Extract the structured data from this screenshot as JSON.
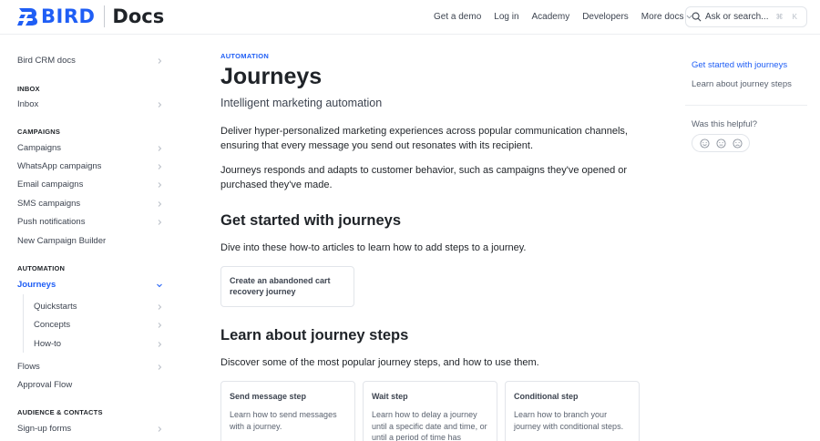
{
  "brand": {
    "name": "BIRD",
    "section": "Docs",
    "color": "#1f5ef5"
  },
  "topnav": {
    "items": [
      "Get a demo",
      "Log in",
      "Academy",
      "Developers"
    ],
    "more_label": "More docs"
  },
  "search": {
    "placeholder": "Ask or search...",
    "shortcut": "⌘ K"
  },
  "sidebar": {
    "top_item": "Bird CRM docs",
    "inbox_heading": "INBOX",
    "inbox_items": [
      "Inbox"
    ],
    "campaigns_heading": "CAMPAIGNS",
    "campaigns_items": [
      "Campaigns",
      "WhatsApp campaigns",
      "Email campaigns",
      "SMS campaigns",
      "Push notifications",
      "New Campaign Builder"
    ],
    "automation_heading": "AUTOMATION",
    "active_item": "Journeys",
    "journeys_children": [
      "Quickstarts",
      "Concepts",
      "How-to"
    ],
    "automation_items": [
      "Flows",
      "Approval Flow"
    ],
    "audience_heading": "AUDIENCE & CONTACTS",
    "audience_items": [
      "Sign-up forms"
    ]
  },
  "main": {
    "eyebrow": "AUTOMATION",
    "title": "Journeys",
    "subtitle": "Intelligent marketing automation",
    "para1": "Deliver hyper-personalized marketing experiences across popular communication channels, ensuring that every message you send out resonates with its recipient.",
    "para2": "Journeys responds and adapts to customer behavior, such as campaigns they've opened or purchased they've made.",
    "section1_heading": "Get started with journeys",
    "section1_text": "Dive into these how-to articles to learn how to add steps to a journey.",
    "section1_card": "Create an abandoned cart recovery journey",
    "section2_heading": "Learn about journey steps",
    "section2_text": "Discover some of the most popular journey steps, and how to use them.",
    "step_cards": [
      {
        "title": "Send message step",
        "desc": "Learn how to send messages with a journey."
      },
      {
        "title": "Wait step",
        "desc": "Learn how to delay a journey until a specific date and time, or until a period of time has"
      },
      {
        "title": "Conditional step",
        "desc": "Learn how to branch your journey with conditional steps."
      }
    ]
  },
  "toc": {
    "items": [
      "Get started with journeys",
      "Learn about journey steps"
    ],
    "active_color": "#1f5ef5"
  },
  "feedback": {
    "question": "Was this helpful?",
    "faces": [
      "happy-face-icon",
      "neutral-face-icon",
      "sad-face-icon"
    ]
  }
}
